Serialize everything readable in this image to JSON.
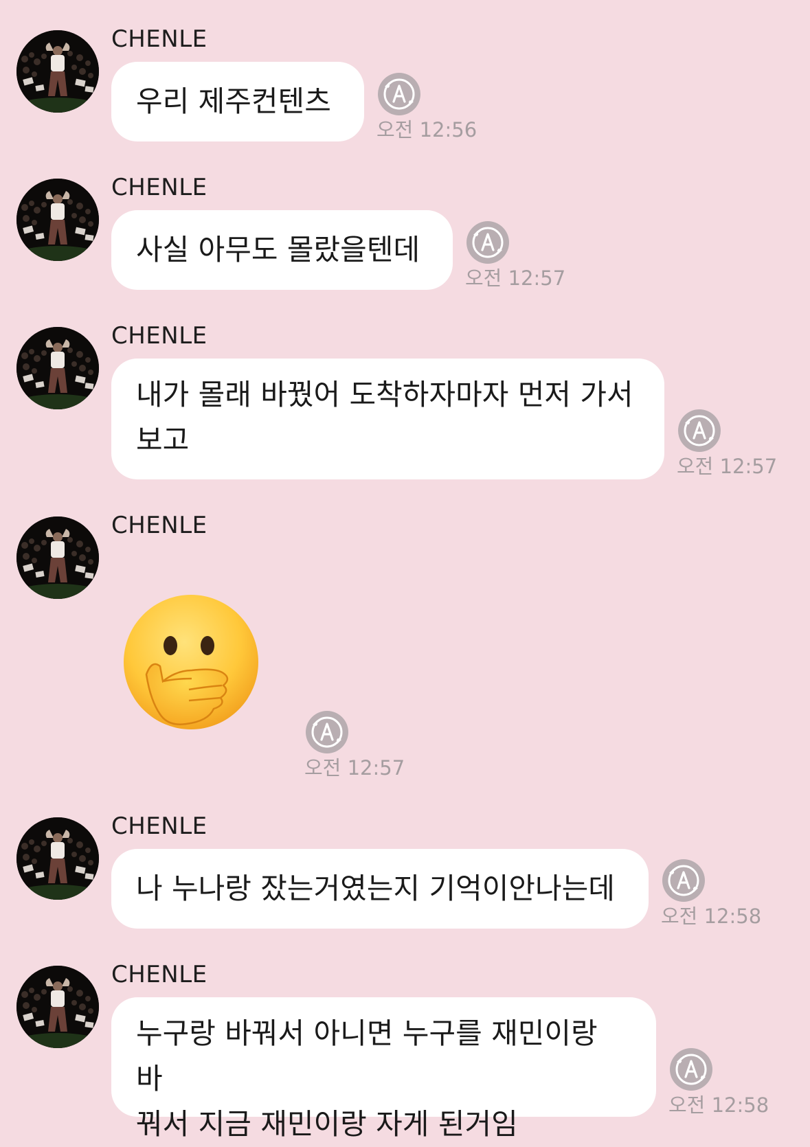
{
  "chat": {
    "messages": [
      {
        "sender": "CHENLE",
        "text": "우리 제주컨텐츠",
        "time": "오전 12:56"
      },
      {
        "sender": "CHENLE",
        "text": "사실 아무도 몰랐을텐데",
        "time": "오전 12:57"
      },
      {
        "sender": "CHENLE",
        "lines": [
          "내가 몰래 바꿨어 도착하자마자 먼저 가서",
          "보고"
        ],
        "time": "오전 12:57"
      },
      {
        "sender": "CHENLE",
        "emoji": "face-with-hand-over-mouth-emoji",
        "time": "오전 12:57"
      },
      {
        "sender": "CHENLE",
        "text": "나 누나랑 잤는거였는지 기억이안나는데",
        "time": "오전 12:58"
      },
      {
        "sender": "CHENLE",
        "lines": [
          "누구랑 바꿔서 아니면 누구를 재민이랑 바",
          "꿔서 지금 재민이랑 자게 된거임"
        ],
        "time": "오전 12:58"
      }
    ]
  },
  "colors": {
    "background": "#f5dbe1",
    "bubble": "#ffffff",
    "timestamp": "#a59da0",
    "translate_icon": "#b9aeb2"
  },
  "icons": {
    "translate": "translate-icon",
    "avatar": "avatar"
  }
}
